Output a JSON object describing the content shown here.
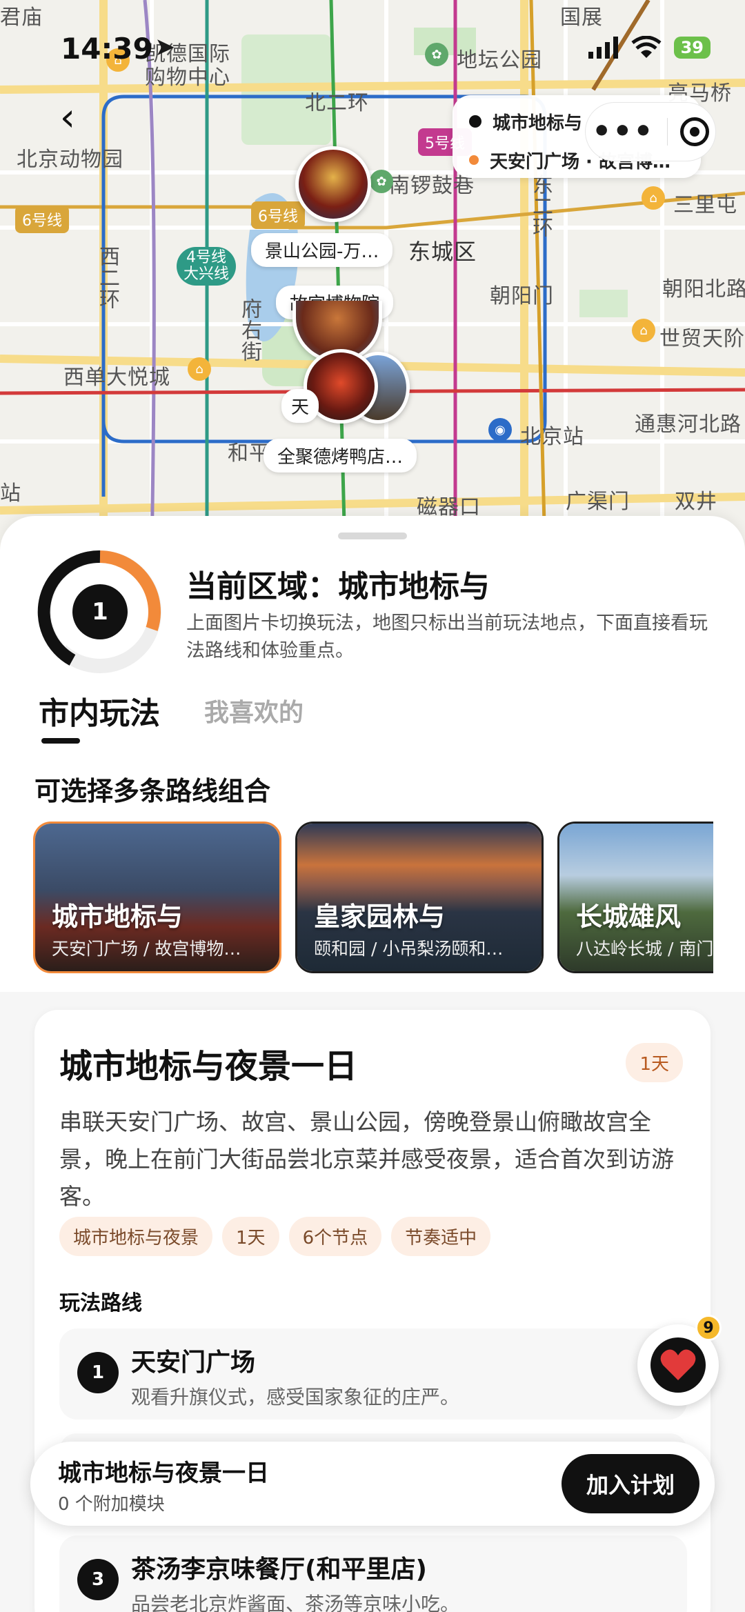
{
  "status": {
    "time": "14:39",
    "battery": "39"
  },
  "map": {
    "labels": {
      "junmiao": "君庙",
      "guozhan": "国展",
      "mall": "凯德国际购物中心",
      "ditan": "地坛公园",
      "liangma": "亮马桥",
      "beierhuan": "北二环",
      "zoo": "北京动物园",
      "nanluogu": "南锣鼓巷",
      "sanlitun": "三里屯",
      "dongcheng": "东城区",
      "chaoyangmen": "朝阳门",
      "chaoyangbei": "朝阳北路",
      "xisi": "西单大悦城",
      "maotan": "世贸天阶",
      "beijingzhan": "北京站",
      "tonghui": "通惠河北路",
      "cikou": "磁器口",
      "guangqumen": "广渠门",
      "shuangjing": "双井",
      "he_ping": "和平门",
      "fuyoujie": "府右街",
      "xierhuan": "西二环",
      "dongerhuan": "东二环",
      "zhan": "站",
      "tian": "天"
    },
    "line_badges": {
      "line6_left": "6号线",
      "line6_mid": "6号线",
      "line4": "4号线\n大兴线",
      "line5": "5号线"
    },
    "markers": {
      "jingshan": "景山公园-万…",
      "gugong": "故宫博物院",
      "quanjude": "全聚德烤鸭店…"
    }
  },
  "capsule": {
    "row1": "城市地标与",
    "row2": "天安门广场 · 故宫博…"
  },
  "region": {
    "number": "1",
    "title": "当前区域：城市地标与",
    "desc": "上面图片卡切换玩法，地图只标出当前玩法地点，下面直接看玩法路线和体验重点。"
  },
  "tabs": [
    {
      "label": "市内玩法"
    },
    {
      "label": "我喜欢的"
    }
  ],
  "routes_section": {
    "label": "可选择多条路线组合"
  },
  "route_cards": [
    {
      "title": "城市地标与",
      "sub": "天安门广场 / 故宫博物…"
    },
    {
      "title": "皇家园林与",
      "sub": "颐和园 / 小吊梨汤颐和…"
    },
    {
      "title": "长城雄风",
      "sub": "八达岭长城 / 南门"
    }
  ],
  "detail": {
    "title": "城市地标与夜景一日",
    "duration": "1天",
    "desc": "串联天安门广场、故宫、景山公园，傍晚登景山俯瞰故宫全景，晚上在前门大街品尝北京菜并感受夜景，适合首次到访游客。",
    "tags": [
      "城市地标与夜景",
      "1天",
      "6个节点",
      "节奏适中"
    ],
    "path_label": "玩法路线",
    "stops": [
      {
        "num": "1",
        "name": "天安门广场",
        "note": "观看升旗仪式，感受国家象征的庄严。"
      },
      {
        "num": "3",
        "name": "茶汤李京味餐厅(和平里店)",
        "note": "品尝老北京炸酱面、茶汤等京味小吃。"
      }
    ]
  },
  "favorites": {
    "count": "9"
  },
  "plan_bar": {
    "title": "城市地标与夜景一日",
    "sub": "0 个附加模块",
    "button": "加入计划"
  },
  "colors": {
    "accent": "#f28a3a",
    "dark": "#111111",
    "tag_bg": "#fdeee4"
  }
}
